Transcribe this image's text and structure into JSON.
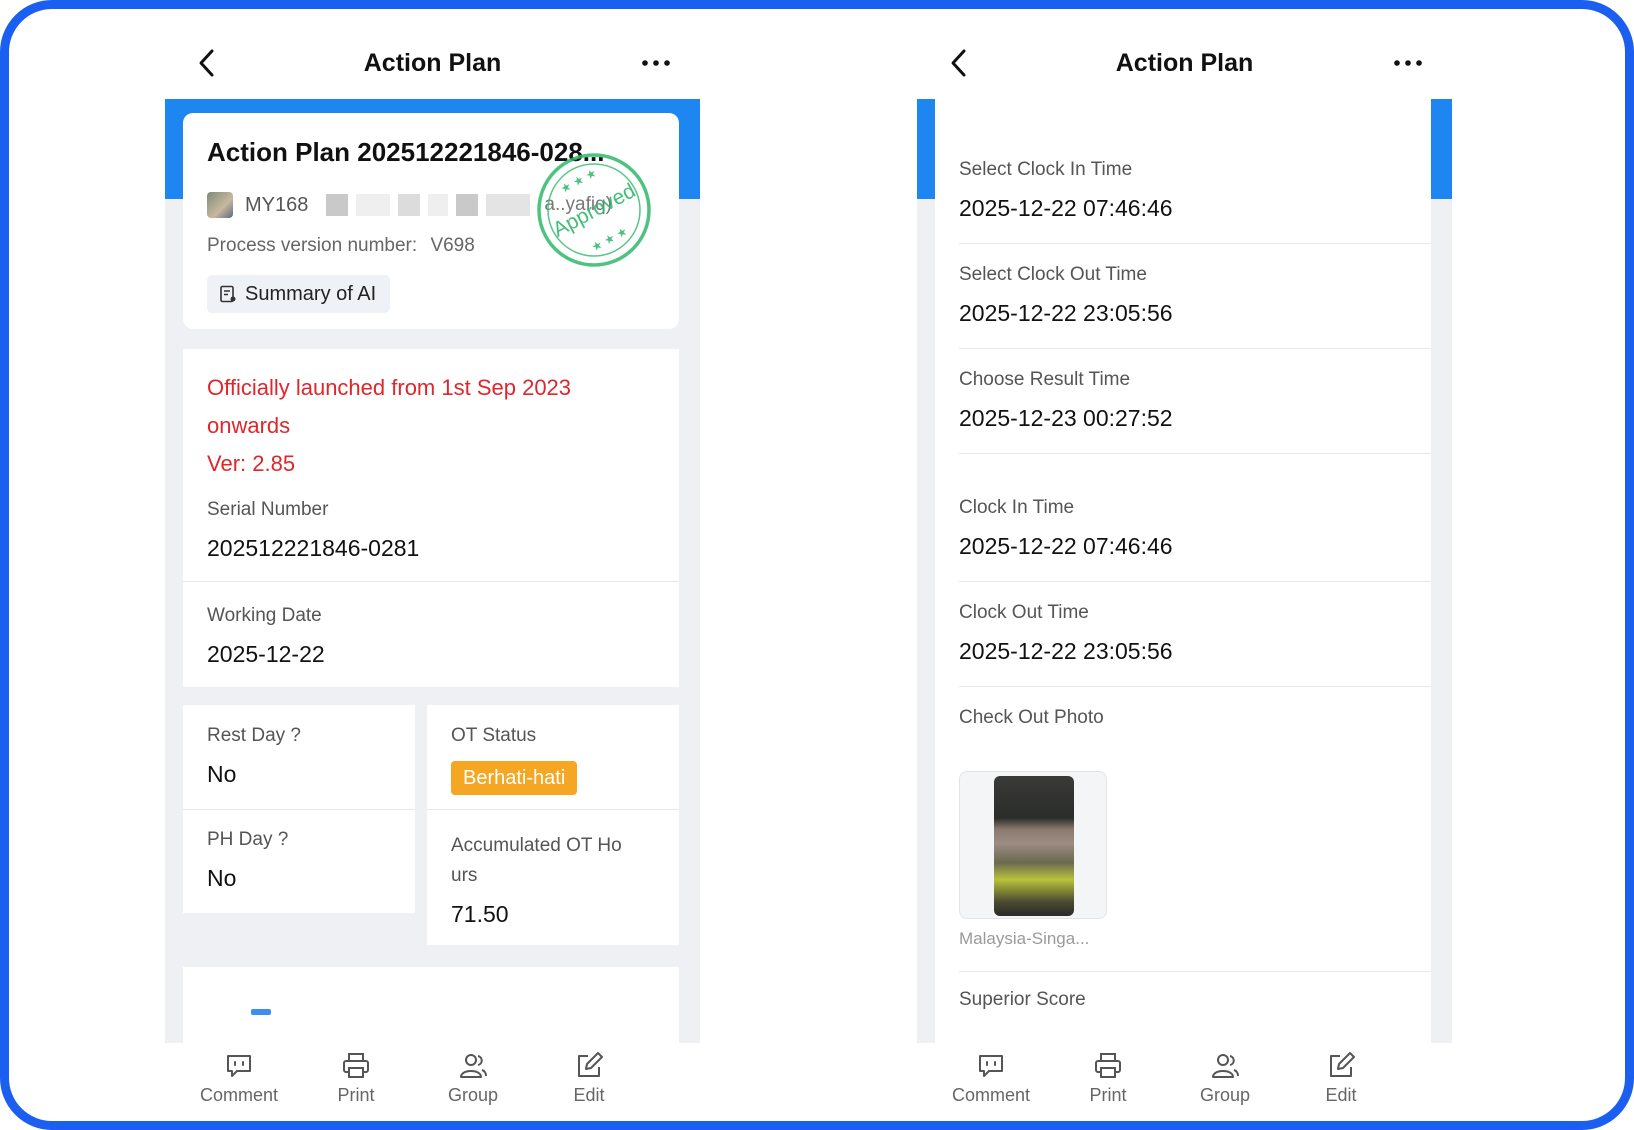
{
  "left": {
    "title": "Action Plan",
    "header": {
      "plan_title": "Action Plan 202512221846-028...",
      "user_code": "MY168",
      "user_tail": "a..yafiq)",
      "version_label": "Process version number:",
      "version_value": "V698",
      "ai_summary_label": "Summary of AI",
      "stamp_text": "Approved"
    },
    "notice": {
      "line1": "Officially launched from 1st Sep 2023",
      "line2": "onwards",
      "line3": "Ver: 2.85"
    },
    "serial": {
      "label": "Serial Number",
      "value": "202512221846-0281"
    },
    "working_date": {
      "label": "Working Date",
      "value": "2025-12-22"
    },
    "rest_day": {
      "label": "Rest Day ?",
      "value": "No"
    },
    "ph_day": {
      "label": "PH Day ?",
      "value": "No"
    },
    "ot_status": {
      "label": "OT Status",
      "value": "Berhati-hati"
    },
    "accumulated_ot": {
      "label_line1": "Accumulated OT Ho",
      "label_line2": "urs",
      "value": "71.50"
    }
  },
  "right": {
    "title": "Action Plan",
    "fields": [
      {
        "label": "Select Clock In Time",
        "value": "2025-12-22 07:46:46"
      },
      {
        "label": "Select Clock Out Time",
        "value": "2025-12-22 23:05:56"
      },
      {
        "label": "Choose Result Time",
        "value": "2025-12-23 00:27:52"
      },
      {
        "label": "Clock In Time",
        "value": "2025-12-22 07:46:46"
      },
      {
        "label": "Clock Out Time",
        "value": "2025-12-22 23:05:56"
      }
    ],
    "photo_label": "Check Out Photo",
    "photo_caption": "Malaysia-Singa...",
    "partial_label": "Superior Score"
  },
  "toolbar": {
    "comment": "Comment",
    "print": "Print",
    "group": "Group",
    "edit": "Edit"
  },
  "colors": {
    "frame": "#1a5ff0",
    "accent_blue": "#1e86f0",
    "notice_red": "#e0262a",
    "tag_orange": "#f5a623",
    "stamp_green": "#2fb86a"
  }
}
